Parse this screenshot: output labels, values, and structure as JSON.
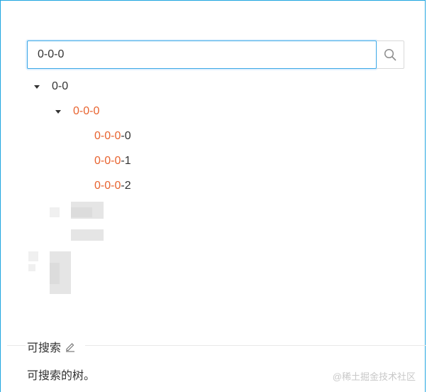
{
  "search": {
    "value": "0-0-0"
  },
  "tree": {
    "root": {
      "prefix": "",
      "match": "",
      "rest": "0-0"
    },
    "child": {
      "prefix": "",
      "match": "0-0-0",
      "rest": ""
    },
    "leaves": [
      {
        "match": "0-0-0",
        "rest": "-0"
      },
      {
        "match": "0-0-0",
        "rest": "-1"
      },
      {
        "match": "0-0-0",
        "rest": "-2"
      }
    ]
  },
  "section": {
    "title": "可搜索",
    "description": "可搜索的树。"
  },
  "watermark": "@稀土掘金技术社区",
  "colors": {
    "highlight": "#e8632f",
    "accent_border": "#3aa7e6",
    "text": "#333333"
  },
  "icons": {
    "search": "search-icon",
    "edit": "edit-icon",
    "caret": "caret-down-icon"
  }
}
